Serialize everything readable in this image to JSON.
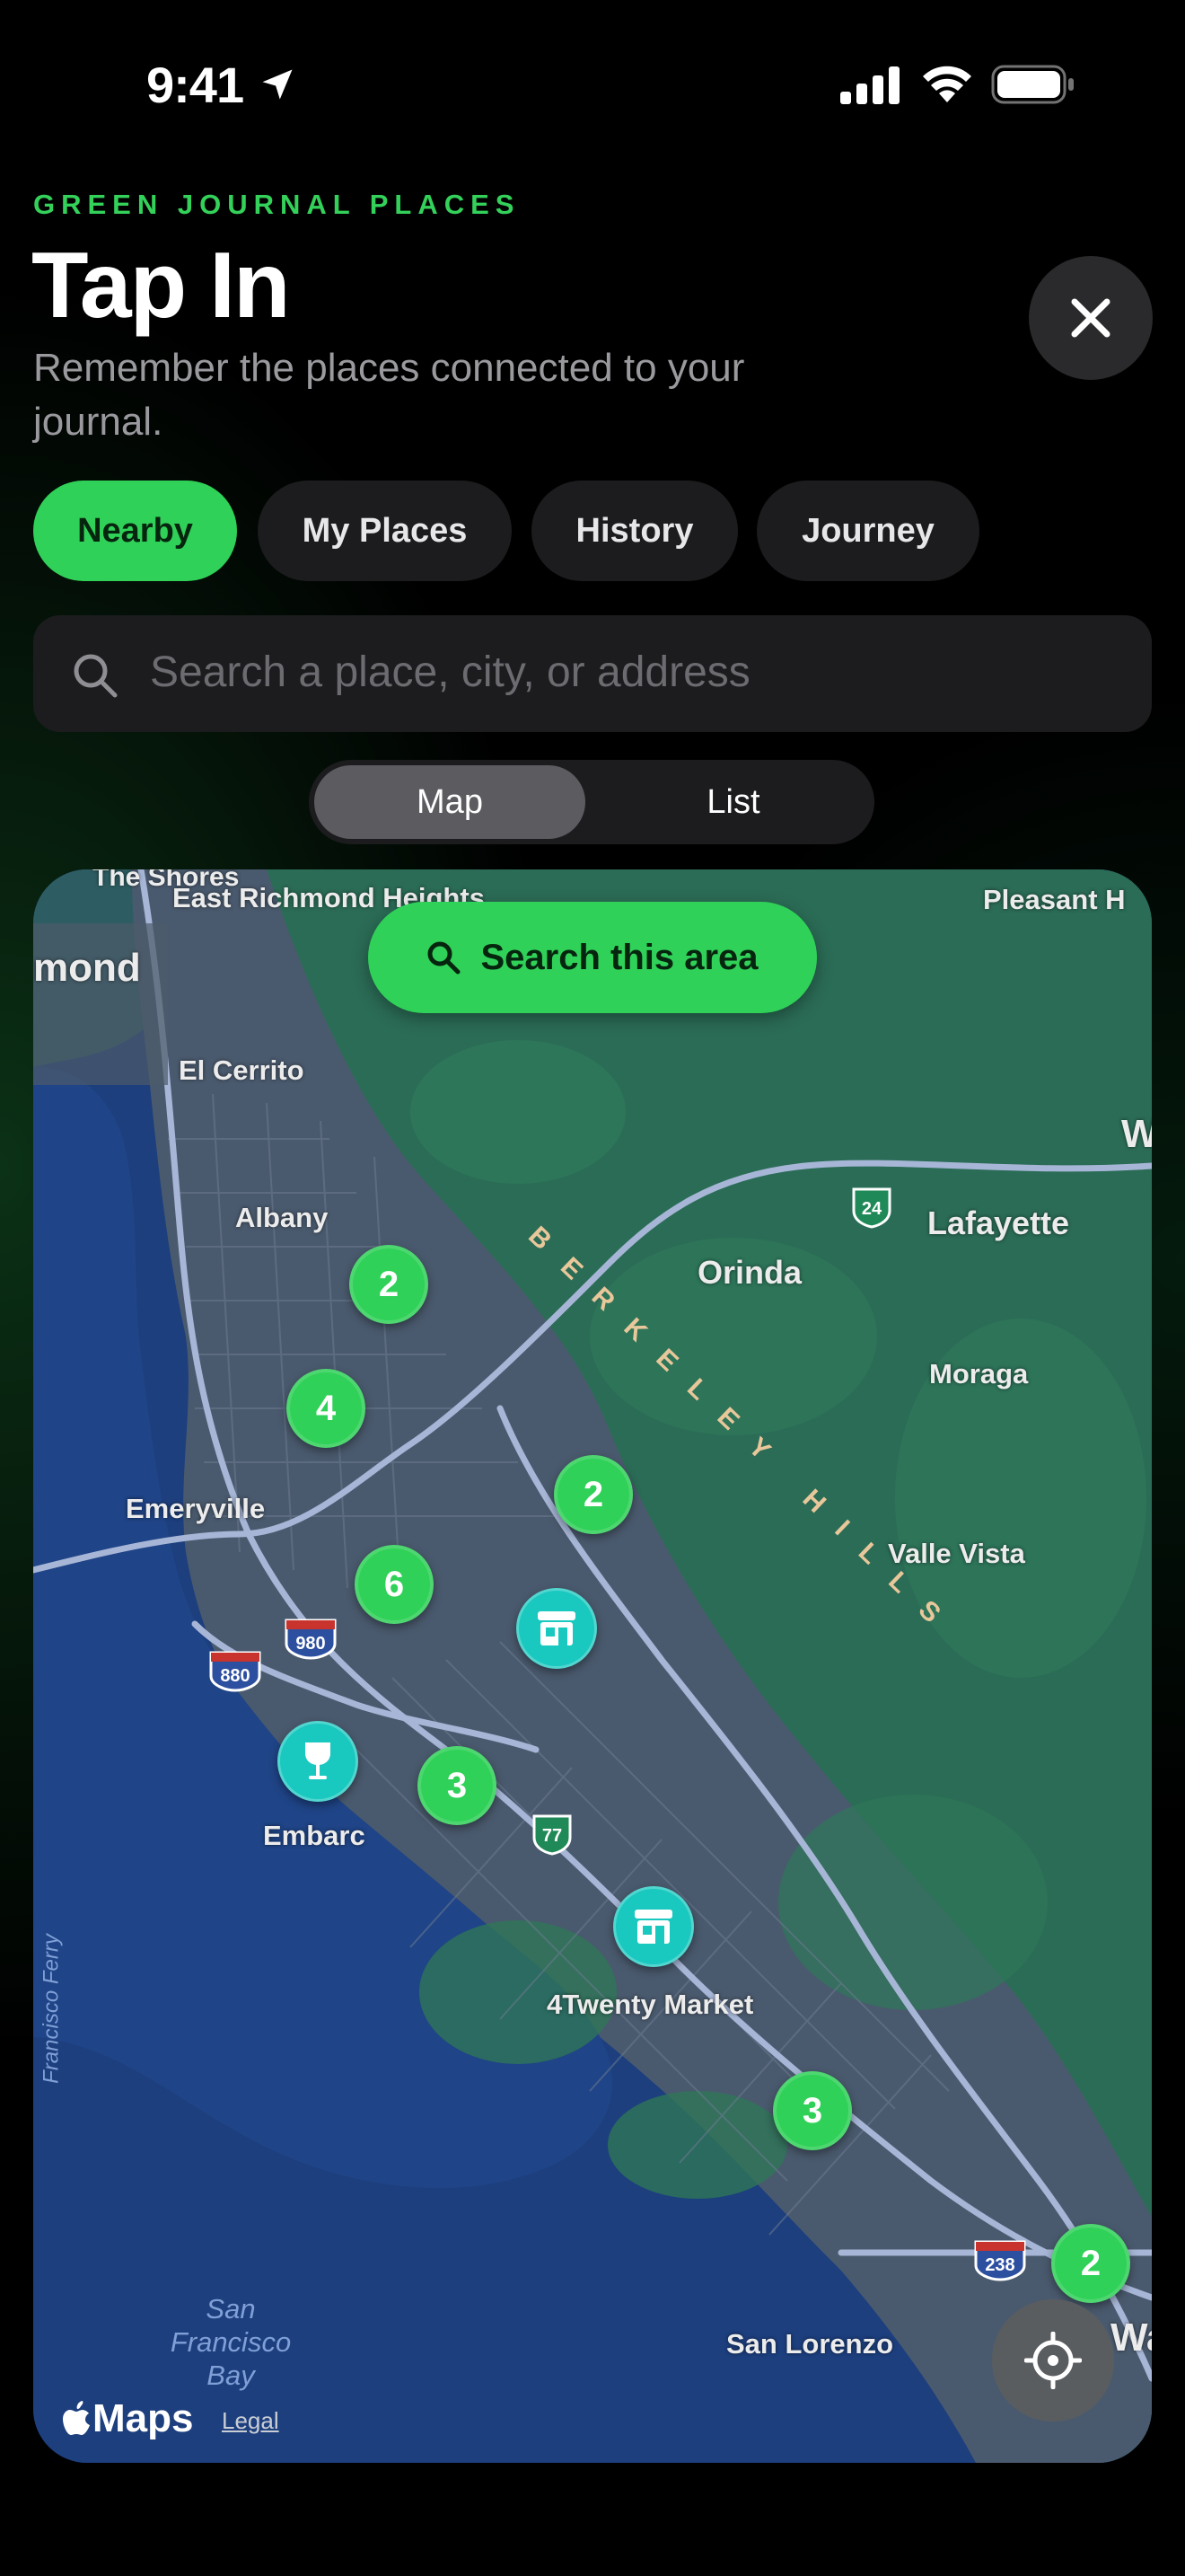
{
  "status_bar": {
    "time": "9:41"
  },
  "header": {
    "eyebrow": "GREEN JOURNAL PLACES",
    "title": "Tap In",
    "subtitle": "Remember the places connected to your journal."
  },
  "filters": [
    {
      "label": "Nearby",
      "active": true
    },
    {
      "label": "My Places",
      "active": false
    },
    {
      "label": "History",
      "active": false
    },
    {
      "label": "Journey",
      "active": false
    }
  ],
  "search": {
    "placeholder": "Search a place, city, or address"
  },
  "view_toggle": {
    "options": [
      "Map",
      "List"
    ],
    "selected": "Map"
  },
  "map": {
    "search_area_label": "Search this area",
    "place_labels": {
      "east_richmond": "East Richmond Heights",
      "richmond": "mond",
      "el_cerrito": "El Cerrito",
      "albany": "Albany",
      "orinda": "Orinda",
      "lafayette": "Lafayette",
      "moraga": "Moraga",
      "emeryville": "Emeryville",
      "valle_vista": "Valle Vista",
      "embarc": "Embarc",
      "market": "4Twenty Market",
      "san_lorenzo": "San Lorenzo",
      "pleasant": "Pleasant H",
      "sf_bay": "San Francisco Bay",
      "sf_ferry": "Francisco Ferry",
      "the_shores": "The Shores",
      "wa": "Wa",
      "wc": "W C"
    },
    "hills_label": "BERKELEY HILLS",
    "highways": [
      "24",
      "980",
      "880",
      "77",
      "238"
    ],
    "clusters": [
      2,
      4,
      2,
      6,
      3,
      3,
      2
    ],
    "attribution": {
      "brand": "Maps",
      "legal": "Legal"
    }
  },
  "colors": {
    "accent": "#30d158",
    "poi": "#19c8bf",
    "background": "#000000"
  }
}
